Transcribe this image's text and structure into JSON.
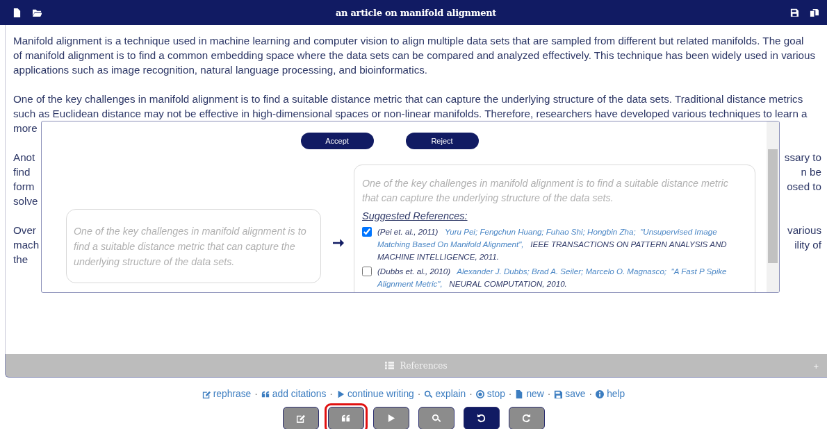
{
  "header": {
    "title": "an article on manifold alignment"
  },
  "document": {
    "paragraphs": [
      {
        "lines": [
          {
            "left": "Manifold alignment is a technique used in machine learning and computer vision to align multiple data sets that are sampled from different but related manifolds. The goal"
          },
          {
            "left": "of manifold alignment is to find a common embedding space where the data sets can be compared and analyzed effectively. This technique has been widely used in various"
          },
          {
            "left": "applications such as image recognition, natural language processing, and bioinformatics."
          }
        ]
      },
      {
        "lines": [
          {
            "left": "One of the key challenges in manifold alignment is to find a suitable distance metric that can capture the underlying structure of the data sets. Traditional distance metrics"
          },
          {
            "left": "such as Euclidean distance may not be effective in high-dimensional spaces or non-linear manifolds. Therefore, researchers have developed various techniques to learn a"
          },
          {
            "left": "more"
          }
        ]
      },
      {
        "lines": [
          {
            "left": "Anot",
            "right": "ssary to"
          },
          {
            "left": "find",
            "right": "n be"
          },
          {
            "left": "form",
            "right": "osed to"
          },
          {
            "left": "solve"
          }
        ]
      },
      {
        "lines": [
          {
            "left": "Over",
            "right": "various"
          },
          {
            "left": "mach",
            "right": "ility of"
          },
          {
            "left": "the"
          }
        ]
      }
    ]
  },
  "popup": {
    "buttons": [
      {
        "label": "Accept"
      },
      {
        "label": "Reject"
      }
    ],
    "original": "One of the key challenges in manifold alignment is to find a suitable distance metric that can capture the underlying structure of the data sets.",
    "suggestion": {
      "text": "One of the key challenges in manifold alignment is to find a suitable distance metric that can capture the underlying structure of the data sets.",
      "heading": "Suggested References:",
      "references": [
        {
          "checked": true,
          "cite": "(Pei et. al., 2011)",
          "authors": "Yuru Pei; Fengchun Huang; Fuhao Shi; Hongbin Zha;",
          "title": "\"Unsupervised Image Matching Based On Manifold Alignment\",",
          "venue": "IEEE TRANSACTIONS ON PATTERN ANALYSIS AND MACHINE INTELLIGENCE,  2011."
        },
        {
          "checked": false,
          "cite": "(Dubbs et. al., 2010)",
          "authors": "Alexander J. Dubbs; Brad A. Seiler; Marcelo O. Magnasco;",
          "title": "\"A Fast P Spike Alignment Metric\",",
          "venue": "NEURAL COMPUTATION,  2010."
        }
      ]
    }
  },
  "references_bar": {
    "label": "References",
    "expand": "+"
  },
  "actions": {
    "separator": "·",
    "items": [
      {
        "label": "rephrase",
        "kind": "edit"
      },
      {
        "label": "add citations",
        "kind": "quote"
      },
      {
        "label": "continue writing",
        "kind": "play"
      },
      {
        "label": "explain",
        "kind": "search"
      },
      {
        "label": "stop",
        "kind": "stop"
      },
      {
        "label": "new",
        "kind": "file"
      },
      {
        "label": "save",
        "kind": "save"
      },
      {
        "label": "help",
        "kind": "info"
      }
    ]
  },
  "tool_buttons": [
    {
      "kind": "edit",
      "active": false,
      "highlighted": false
    },
    {
      "kind": "quote",
      "active": false,
      "highlighted": true
    },
    {
      "kind": "play",
      "active": false,
      "highlighted": false
    },
    {
      "kind": "search",
      "active": false,
      "highlighted": false
    },
    {
      "kind": "undo",
      "active": true,
      "highlighted": false
    },
    {
      "kind": "redo",
      "active": false,
      "highlighted": false
    }
  ]
}
